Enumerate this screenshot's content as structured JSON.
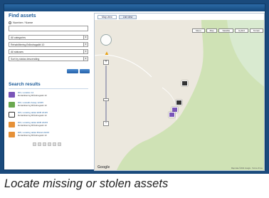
{
  "panel": {
    "title": "Find assets",
    "search_mode": "Number / Name"
  },
  "filters": [
    {
      "label": "All categories"
    },
    {
      "label": "Rehabilitering Bråndragsätt 10"
    },
    {
      "label": "All statuses"
    },
    {
      "label": "Sort by status descending"
    }
  ],
  "results": {
    "title": "Search results",
    "items": [
      {
        "id": "#01, Location 12",
        "line2": "Rehabilitering Bråndragsätt 10",
        "color": "#7a55b8"
      },
      {
        "id": "#02, Lowadin Assay 12345",
        "line2": "Rehabilitering Bråndragsätt 10",
        "color": "#6aa84f"
      },
      {
        "id": "#03, Locating tablet EKB 24115",
        "line2": "Rehabilitering Bråndragsätt 10",
        "color": "#333333"
      },
      {
        "id": "#04, Locating tablet EKB 24215",
        "line2": "Rehabilitering Bråndragsätt 10",
        "color": "#e69138"
      },
      {
        "id": "#05, Locating tablet Bränd 24215",
        "line2": "Rehabilitering Bråndragsätt 10",
        "color": "#e69138"
      }
    ]
  },
  "map": {
    "tabs": [
      "Map view",
      "List view"
    ],
    "types": [
      "Menu",
      "Map",
      "Satellite",
      "Hybrid",
      "Terrain"
    ],
    "logo": "Google",
    "attribution": "Map data ©2011 Google · Terms of Use"
  },
  "caption": "Locate missing or stolen assets"
}
